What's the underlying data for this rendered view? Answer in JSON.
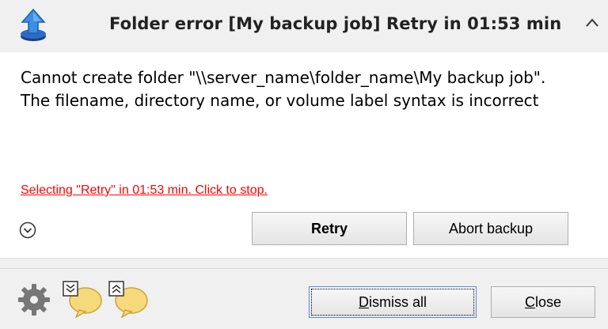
{
  "header": {
    "title": "Folder error [My backup job] Retry in 01:53 min",
    "app_icon": "blue-upload-arrow-icon",
    "collapse_icon": "chevron-up-icon"
  },
  "message": {
    "line1": "Cannot create folder \"\\\\server_name\\folder_name\\My backup job\".",
    "line2": "The filename, directory name, or volume label syntax is incorrect"
  },
  "countdown": "Selecting \"Retry\" in 01:53 min. Click to stop.",
  "buttons": {
    "retry": "Retry",
    "abort": "Abort backup"
  },
  "footer": {
    "dismiss_first": "D",
    "dismiss_rest": "ismiss all",
    "close_first": "C",
    "close_rest": "lose",
    "icons": [
      "gear-icon",
      "collapse-all-bubble-icon",
      "expand-all-bubble-icon"
    ]
  },
  "colors": {
    "countdown": "#ff0000",
    "accent_blue": "#2a7fd4"
  }
}
